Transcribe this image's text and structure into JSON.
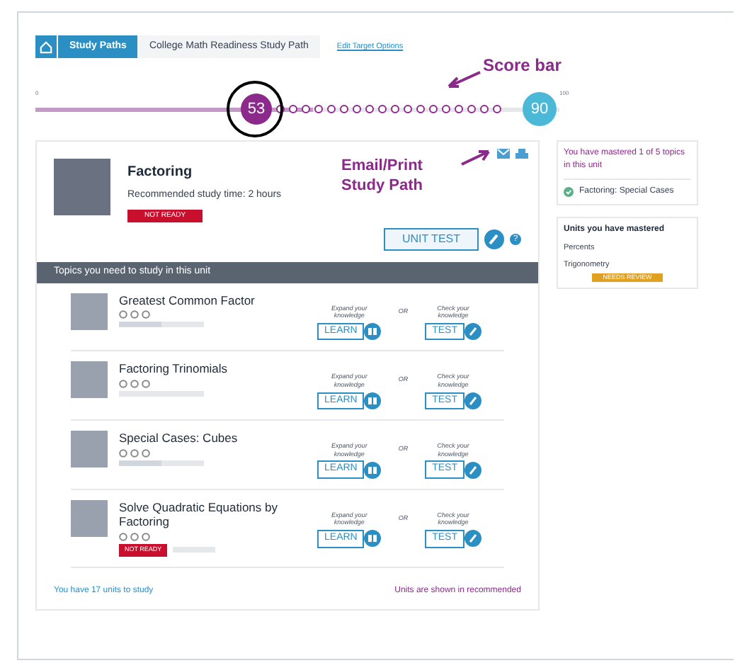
{
  "breadcrumb": {
    "items": [
      {
        "label": "Study Paths",
        "selected": true
      },
      {
        "label": "College Math Readiness Study Path",
        "selected": false
      }
    ],
    "link": "Edit Target Options"
  },
  "score_bar": {
    "min": "0",
    "max": "100",
    "score": "53",
    "target": "90",
    "level": 0.53,
    "annotation": "Score bar"
  },
  "unit": {
    "title": "Factoring",
    "study_time": "Recommended study time: 2 hours",
    "status": "NOT READY",
    "test_button": "UNIT TEST",
    "help": "?",
    "annotation": "Email/Print Study Path",
    "section": "Topics you need to study in this unit"
  },
  "topics": [
    {
      "title": "Greatest Common Factor",
      "level": 0.5,
      "expand": "Expand your knowledge",
      "or": "OR",
      "check": "Check your knowledge",
      "learn": "LEARN",
      "test": "TEST"
    },
    {
      "title": "Factoring Trinomials",
      "level": 0,
      "expand": "Expand your knowledge",
      "or": "OR",
      "check": "Check your knowledge",
      "learn": "LEARN",
      "test": "TEST"
    },
    {
      "title": "Special Cases: Cubes",
      "level": 0.5,
      "expand": "Expand your knowledge",
      "or": "OR",
      "check": "Check your knowledge",
      "learn": "LEARN",
      "test": "TEST"
    },
    {
      "title": "Solve Quadratic Equations by Factoring",
      "level": 0,
      "status": "NOT READY",
      "expand": "Expand your knowledge",
      "or": "OR",
      "check": "Check your knowledge",
      "learn": "LEARN",
      "test": "TEST"
    }
  ],
  "footer": {
    "units": "You have 17 units to study",
    "order": "Units are shown in recommended"
  },
  "sidebar": {
    "mastered_topics": "You have mastered 1 of 5 topics in this unit",
    "topics": [
      "Factoring: Special Cases"
    ],
    "units_title": "Units you have mastered",
    "units": [
      {
        "name": "Percents"
      },
      {
        "name": "Trigonometry",
        "status": "NEEDS REVIEW"
      }
    ]
  }
}
